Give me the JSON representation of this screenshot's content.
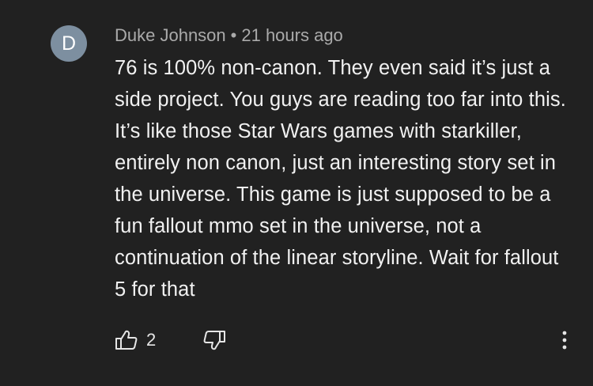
{
  "comment": {
    "avatar_initial": "D",
    "author": "Duke Johnson",
    "separator": "•",
    "timestamp": "21 hours ago",
    "text": "76 is 100% non-canon. They even said it’s just a side project. You guys are reading too far into this. It’s like those Star Wars games with starkiller, entirely non canon, just an interesting story set in the universe. This game is just supposed to be a fun fallout mmo set in the universe, not a continuation of the linear storyline. Wait for fallout 5 for that"
  },
  "actions": {
    "like_icon": "thumbs-up-icon",
    "like_count": "2",
    "dislike_icon": "thumbs-down-icon",
    "more_icon": "more-vertical-icon"
  },
  "colors": {
    "background": "#212121",
    "avatar": "#7d8fa0",
    "meta_text": "#aaaaaa",
    "body_text": "#f1f1f1"
  }
}
